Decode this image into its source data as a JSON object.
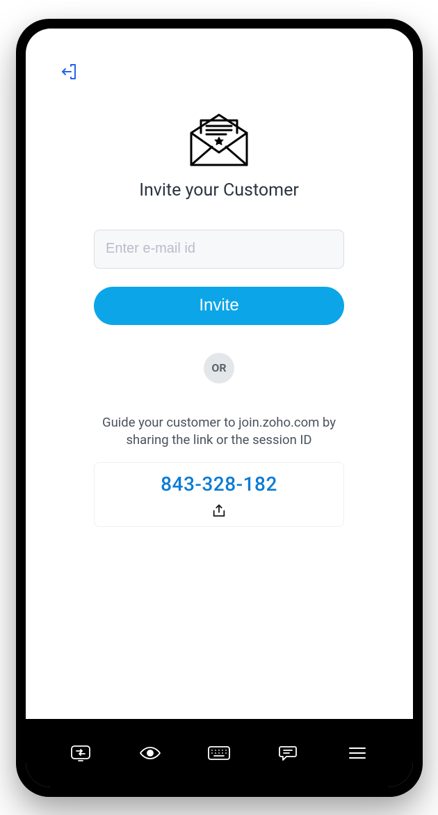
{
  "header": {
    "title": "Invite your Customer"
  },
  "form": {
    "email_placeholder": "Enter e-mail id",
    "invite_label": "Invite"
  },
  "divider": {
    "or_label": "OR"
  },
  "guide": {
    "text": "Guide your customer to join.zoho.com by sharing the link or the session ID"
  },
  "session": {
    "id": "843-328-182"
  },
  "colors": {
    "accent": "#0ca6e8",
    "link": "#0b7bd6"
  },
  "nav": {
    "items": [
      "switch",
      "view",
      "keyboard",
      "chat",
      "menu"
    ]
  }
}
